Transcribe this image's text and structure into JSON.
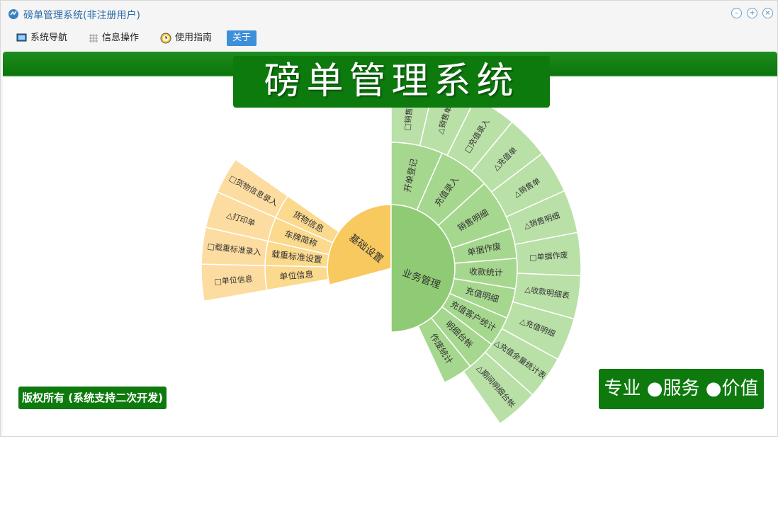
{
  "window": {
    "title": "磅单管理系统(非注册用户)",
    "controls": [
      "minimize-icon",
      "restore-icon",
      "close-icon"
    ]
  },
  "menu": {
    "items": [
      {
        "label": "系统导航",
        "icon": "monitor-icon"
      },
      {
        "label": "信息操作",
        "icon": "grid-icon"
      },
      {
        "label": "使用指南",
        "icon": "clock-icon"
      },
      {
        "label": "关于",
        "icon": ""
      }
    ],
    "active": "关于"
  },
  "banner": {
    "title": "磅单管理系统"
  },
  "footer": {
    "copyright": "版权所有 (系统支持二次开发)",
    "slogan": "专业 ●服务 ●价值"
  },
  "colors": {
    "brand_green": "#0e7a0e",
    "orange_center": "#f7c95e",
    "orange_mid": "#fbd98d",
    "orange_outer": "#fcdca0",
    "green_center": "#8fcb74",
    "green_mid": "#a6d78e",
    "green_outer": "#b9e0a6",
    "menu_active": "#3d8fd9"
  },
  "sunburst": {
    "center": [
      {
        "label": "基础设置",
        "color": "#f7c95e"
      },
      {
        "label": "业务管理",
        "color": "#8fcb74"
      }
    ],
    "mid": [
      {
        "label": "单位信息",
        "group": "orange"
      },
      {
        "label": "载重标准设置",
        "group": "orange"
      },
      {
        "label": "车牌简称",
        "group": "orange"
      },
      {
        "label": "货物信息",
        "group": "orange"
      },
      {
        "label": "开单登记",
        "group": "green"
      },
      {
        "label": "充值录入",
        "group": "green"
      },
      {
        "label": "销售明细",
        "group": "green"
      },
      {
        "label": "单据作废",
        "group": "green"
      },
      {
        "label": "收款统计",
        "group": "green"
      },
      {
        "label": "充值明细",
        "group": "green"
      },
      {
        "label": "充值客户统计",
        "group": "green"
      },
      {
        "label": "明细台帐",
        "group": "green"
      },
      {
        "label": "作废统计",
        "group": "green"
      }
    ],
    "outer": [
      {
        "label": "□单位信息",
        "group": "orange"
      },
      {
        "label": "□载重标准录入",
        "group": "orange"
      },
      {
        "label": "△打印单",
        "group": "orange"
      },
      {
        "label": "□货物信息录入",
        "group": "orange"
      },
      {
        "label": "□销售开单",
        "group": "green"
      },
      {
        "label": "△销售单",
        "group": "green"
      },
      {
        "label": "□充值录入",
        "group": "green"
      },
      {
        "label": "△充值单",
        "group": "green"
      },
      {
        "label": "△销售单",
        "group": "green"
      },
      {
        "label": "△销售明细",
        "group": "green"
      },
      {
        "label": "□单据作废",
        "group": "green"
      },
      {
        "label": "△收款明细表",
        "group": "green"
      },
      {
        "label": "△充值明细",
        "group": "green"
      },
      {
        "label": "△充值余量统计表",
        "group": "green"
      },
      {
        "label": "△期间明细台帐",
        "group": "green"
      }
    ]
  }
}
